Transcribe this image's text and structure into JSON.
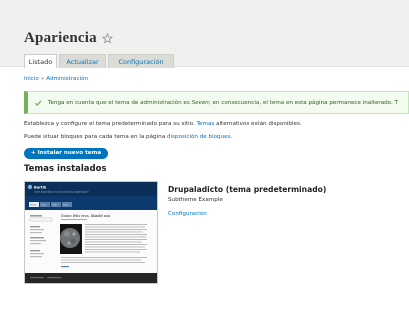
{
  "page": {
    "title": "Apariencia",
    "tabs": [
      "Listado",
      "Actualizar",
      "Configuración"
    ]
  },
  "breadcrumb": [
    "Inicio",
    "Administración"
  ],
  "status_message": {
    "before": "Tenga en cuenta que el tema de administración es ",
    "theme": "Seven",
    "after": "; en consecuencia, el tema en esta página permanece inalterado. T"
  },
  "intro": {
    "line1_before": "Establezca y configure el tema predeterminado para su sitio. ",
    "line1_link": "Temas",
    "line1_after": " alternativos están disponibles.",
    "line2_before": "Puede situar bloques para cada tema en la página ",
    "line2_link": "disposición de bloques",
    "line2_after": "."
  },
  "install_button": "+ Instalar nuevo tema",
  "installed_heading": "Temas instalados",
  "theme": {
    "name": "Drupaladicto (tema predeterminado)",
    "description": "Subtheme Example",
    "settings_link": "Configuración",
    "preview": {
      "site_name": "Bartik",
      "site_slogan": "Lorem ipsum dolor sit amet consectetur adipiscing elit",
      "nav": [
        "Home",
        "Link",
        "Link",
        "Link"
      ],
      "article_title": "Donec felis eros, blandit non",
      "sidebar_items": [
        "Search",
        "Navigation",
        "Add content",
        "Recent content",
        "Log out"
      ]
    }
  },
  "colors": {
    "link": "#0074bd",
    "button": "#0074bd",
    "message_border": "#77b259",
    "header_bg": "#f0f0ee"
  }
}
